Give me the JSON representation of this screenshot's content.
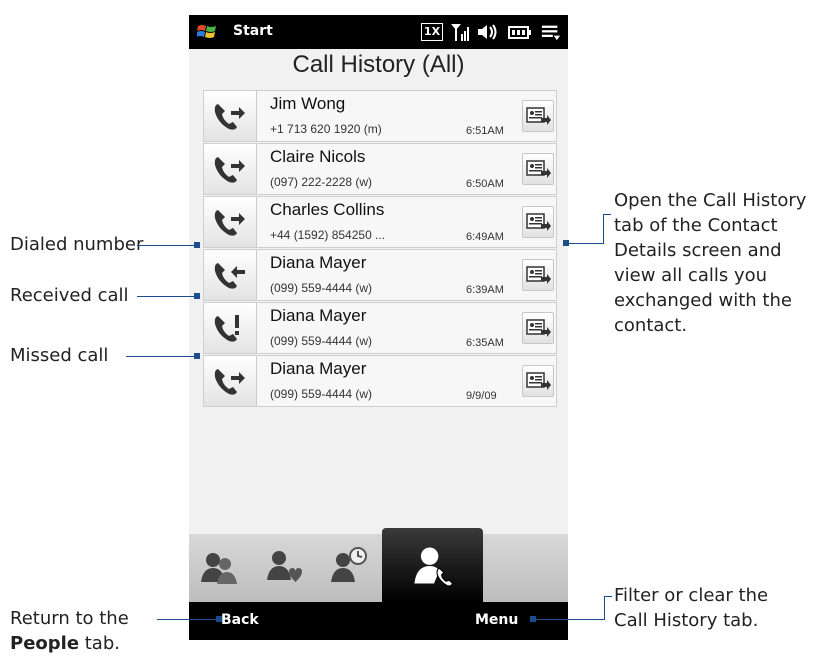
{
  "status_bar": {
    "start_label": "Start",
    "network_label": "1X"
  },
  "screen_title": "Call History (All)",
  "calls": [
    {
      "type": "dialed",
      "name": "Jim Wong",
      "number": "+1 713 620 1920 (m)",
      "time": "6:51AM"
    },
    {
      "type": "dialed",
      "name": "Claire Nicols",
      "number": "(097) 222-2228 (w)",
      "time": "6:50AM"
    },
    {
      "type": "dialed",
      "name": "Charles Collins",
      "number": "+44 (1592) 854250 ...",
      "time": "6:49AM"
    },
    {
      "type": "received",
      "name": "Diana Mayer",
      "number": "(099) 559-4444 (w)",
      "time": "6:39AM"
    },
    {
      "type": "missed",
      "name": "Diana Mayer",
      "number": "(099) 559-4444 (w)",
      "time": "6:35AM"
    },
    {
      "type": "dialed",
      "name": "Diana Mayer",
      "number": "(099) 559-4444 (w)",
      "time": "9/9/09"
    }
  ],
  "bottom_bar": {
    "back_label": "Back",
    "menu_label": "Menu"
  },
  "callouts": {
    "dialed": "Dialed number",
    "received": "Received call",
    "missed": "Missed call",
    "contact_line1": "Open the Call History",
    "contact_line2": "tab of the Contact",
    "contact_line3": "Details screen and",
    "contact_line4": "view all calls you",
    "contact_line5": "exchanged with the",
    "contact_line6": "contact.",
    "back_line1": "Return to the",
    "back_line2_bold": "People",
    "back_line2_rest": " tab.",
    "menu_line1": "Filter or clear the",
    "menu_line2": "Call History tab."
  },
  "colors": {
    "callout_line": "#1a4d8c",
    "bar": "#000000",
    "screen_bg": "#f1f1f1"
  }
}
